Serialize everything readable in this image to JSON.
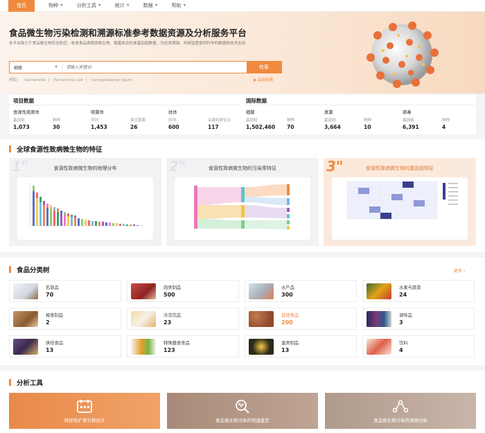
{
  "nav": {
    "items": [
      {
        "label": "首页",
        "active": true
      },
      {
        "label": "物种"
      },
      {
        "label": "分析工具"
      },
      {
        "label": "统计"
      },
      {
        "label": "数据"
      },
      {
        "label": "帮助"
      }
    ]
  },
  "hero": {
    "title": "食品微生物污染检测和溯源标准参考数据资源及分析服务平台",
    "description": "本平台致力于食品微生物安全防控，收录食品源病原微生物、噬菌体及抗体基因组数据，为检测溯源、科研监管提供科学的数据和技术支持",
    "search": {
      "selected": "细菌",
      "placeholder": "请输入关键词",
      "button": "检索"
    },
    "examples_label": "例如：",
    "examples": [
      "Salmonella",
      "Escherichia coli",
      "Campylobacter jejuni"
    ],
    "advanced": "高级检索"
  },
  "stats": {
    "project_title": "项目数据",
    "international_title": "国际数据",
    "groups": [
      {
        "category": "食源性病原体",
        "cells": [
          {
            "label": "基因组",
            "value": "1,073"
          },
          {
            "label": "物种",
            "value": "30"
          }
        ]
      },
      {
        "category": "噬菌体",
        "cells": [
          {
            "label": "序列",
            "value": "1,453"
          },
          {
            "label": "宿主菌属",
            "value": "26"
          }
        ]
      },
      {
        "category": "抗体",
        "cells": [
          {
            "label": "序列",
            "value": "600"
          },
          {
            "label": "关键抗原位点",
            "value": "117"
          }
        ]
      },
      {
        "category": "细菌",
        "cells": [
          {
            "label": "基因组",
            "value": "1,502,460"
          },
          {
            "label": "物种",
            "value": "70"
          }
        ]
      },
      {
        "category": "真菌",
        "cells": [
          {
            "label": "基因组",
            "value": "3,664"
          },
          {
            "label": "物种",
            "value": "10"
          }
        ]
      },
      {
        "category": "病毒",
        "cells": [
          {
            "label": "基因组",
            "value": "6,391"
          },
          {
            "label": "物种",
            "value": "4"
          }
        ]
      }
    ]
  },
  "features": {
    "title": "全球食源性致病微生物的特征",
    "cards": [
      {
        "num": "1\"",
        "title": "食源性致病微生物的地理分布"
      },
      {
        "num": "2\"",
        "title": "食源性致病微生物的污染率特征"
      },
      {
        "num": "3\"",
        "title": "食源性致病微生物的基因组特征"
      }
    ]
  },
  "food": {
    "title": "食品分类树",
    "more": "更多",
    "items": [
      {
        "name": "乳制品",
        "count": "70"
      },
      {
        "name": "肉类制品",
        "count": "500"
      },
      {
        "name": "水产品",
        "count": "300"
      },
      {
        "name": "水果与蔬菜",
        "count": "24"
      },
      {
        "name": "粮食制品",
        "count": "2"
      },
      {
        "name": "冷冻饮品",
        "count": "23"
      },
      {
        "name": "其他食品",
        "count": "200"
      },
      {
        "name": "调味品",
        "count": "3"
      },
      {
        "name": "烘焙食品",
        "count": "13"
      },
      {
        "name": "特殊膳食食品",
        "count": "123"
      },
      {
        "name": "蛋类制品",
        "count": "13"
      },
      {
        "name": "饮料",
        "count": "4"
      }
    ]
  },
  "tools": {
    "title": "分析工具",
    "items": [
      {
        "label": "特异性扩增引物设计"
      },
      {
        "label": "食品微生物污染的快速鉴定"
      },
      {
        "label": "食品微生物污染的溯源分析"
      }
    ]
  },
  "colors": {
    "accent": "#f08a3e"
  }
}
